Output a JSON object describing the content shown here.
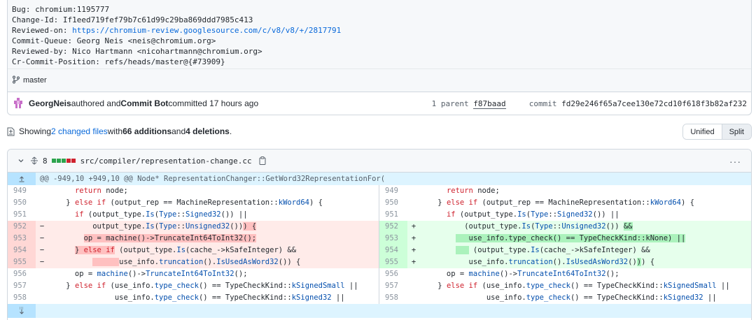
{
  "commit": {
    "lines": {
      "bug": "Bug: chromium:1195777",
      "change_id": "Change-Id: If1eed719fef79b7c61d99c29ba869ddd7985c413",
      "reviewed_on_label": "Reviewed-on: ",
      "reviewed_on_url": "https://chromium-review.googlesource.com/c/v8/v8/+/2817791",
      "commit_queue": "Commit-Queue: Georg Neis <neis@chromium.org>",
      "reviewed_by": "Reviewed-by: Nico Hartmann <nicohartmann@chromium.org>",
      "cr_commit_position": "Cr-Commit-Position: refs/heads/master@{#73909}"
    },
    "branch": "master",
    "author": "GeorgNeis",
    "authored_text": " authored and ",
    "committer": "Commit Bot",
    "committed_text": " committed 17 hours ago",
    "parent_label": "1 parent ",
    "parent_sha": "f87baad",
    "commit_label": "     commit ",
    "commit_sha": "fd29e246f65a7cee130e72cd10f618f3b82af232"
  },
  "summary": {
    "prefix": "Showing ",
    "files": "2 changed files",
    "with": " with ",
    "additions": "66 additions",
    "and": " and ",
    "deletions": "4 deletions",
    "period": "."
  },
  "view_toggle": {
    "unified": "Unified",
    "split": "Split"
  },
  "file": {
    "count": "8",
    "path": "src/compiler/representation-change.cc",
    "more": "···",
    "stat_colors": [
      "#2da44e",
      "#2da44e",
      "#2da44e",
      "#cf222e",
      "#cf222e"
    ],
    "hunk_header": "@@ -949,10 +949,10 @@ Node* RepresentationChanger::GetWord32RepresentationFor(",
    "bottom_expander": "⋯"
  },
  "colors": {
    "accent": "#0969da",
    "add": "#2da44e",
    "del": "#cf222e"
  }
}
